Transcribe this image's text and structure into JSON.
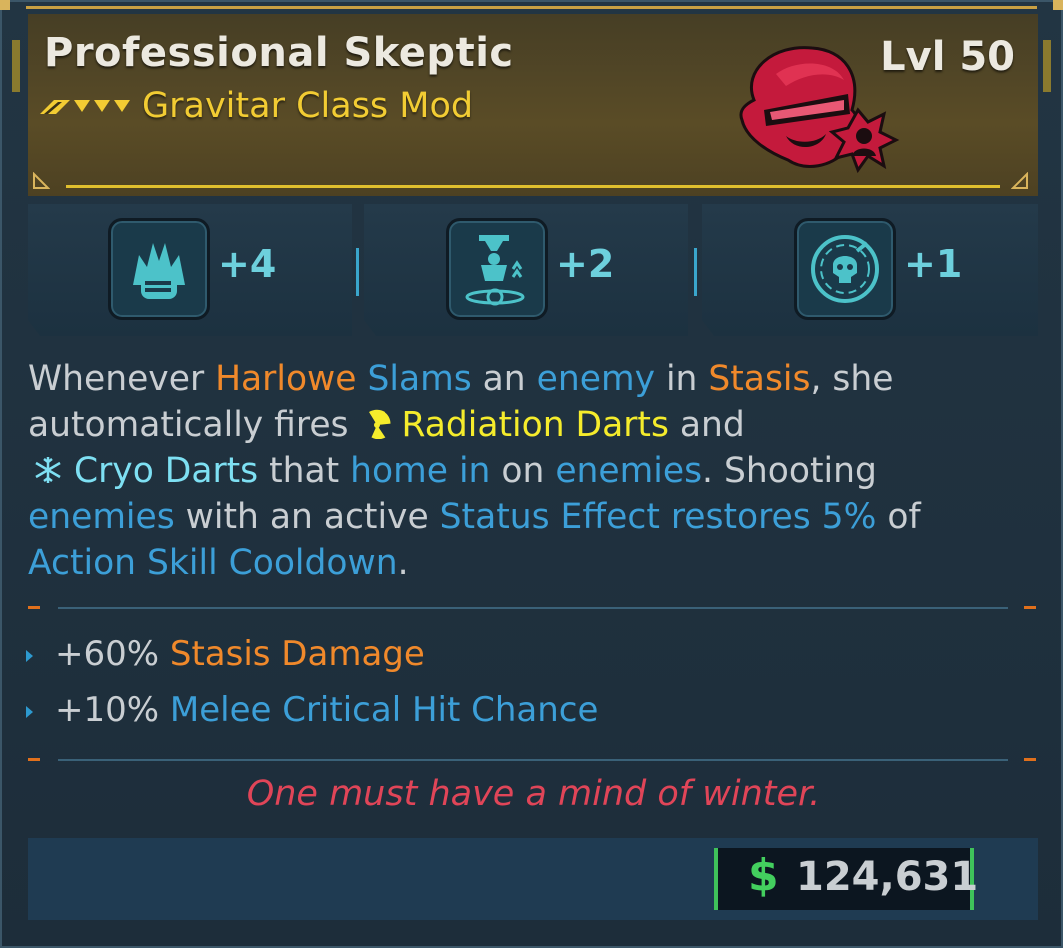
{
  "item": {
    "name": "Professional Skeptic",
    "type": "Gravitar Class Mod",
    "level": "Lvl 50",
    "rarity_icon": "legendary-chevrons-icon",
    "portrait_icon": "harlowe-portrait-icon"
  },
  "skills": [
    {
      "icon": "flame-hand-skill-icon",
      "value": "+4"
    },
    {
      "icon": "gravity-figure-skill-icon",
      "value": "+2"
    },
    {
      "icon": "skull-target-skill-icon",
      "value": "+1"
    }
  ],
  "description": {
    "l1": [
      "Whenever ",
      "Harlowe",
      " ",
      "Slams",
      " an ",
      "enemy",
      " in ",
      "Stasis",
      ", she"
    ],
    "l2": [
      "automatically fires ",
      "Radiation Darts",
      " and"
    ],
    "l3": [
      "Cryo Darts",
      " that ",
      "home in",
      " on ",
      "enemies",
      ". Shooting"
    ],
    "l4": [
      "enemies",
      " with an active ",
      "Status Effect restores 5%",
      " of"
    ],
    "l5": [
      "Action Skill Cooldown",
      "."
    ]
  },
  "stats": [
    {
      "value": "+60%",
      "label": "Stasis Damage"
    },
    {
      "value": "+10%",
      "label": "Melee Critical Hit Chance"
    }
  ],
  "flavor_text": "One must have a mind of winter.",
  "price": {
    "currency_symbol": "$",
    "value": "124,631"
  },
  "colors": {
    "gold": "#f2cc33",
    "orange_keyword": "#f0892b",
    "blue_keyword": "#3c9fd8",
    "radiation": "#f5ec2c",
    "cryo": "#7ee0f3",
    "flavor": "#e04558",
    "money_green": "#43cf5e"
  }
}
